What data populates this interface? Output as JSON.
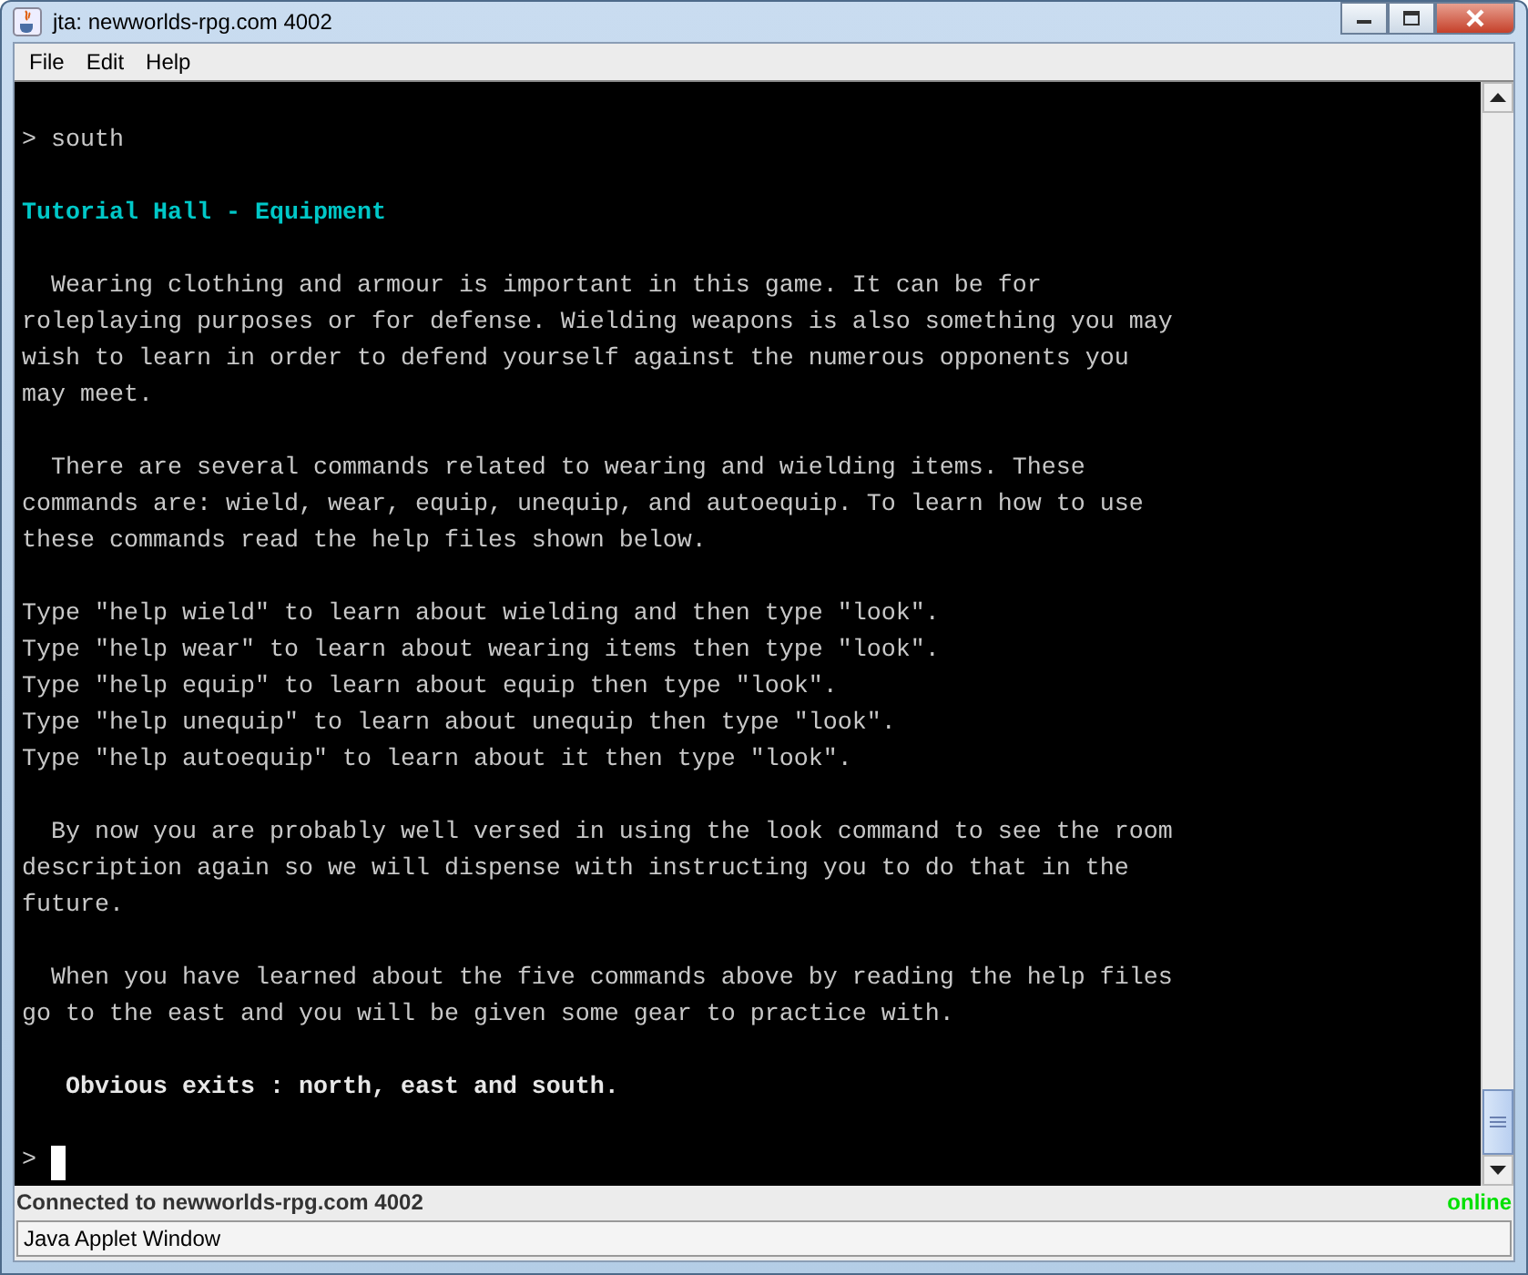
{
  "window": {
    "title": "jta: newworlds-rpg.com 4002"
  },
  "menu": [
    "File",
    "Edit",
    "Help"
  ],
  "terminal": {
    "lines": [
      {
        "kind": "blank"
      },
      {
        "kind": "text",
        "text": "> south"
      },
      {
        "kind": "blank"
      },
      {
        "kind": "heading",
        "text": "Tutorial Hall - Equipment"
      },
      {
        "kind": "blank"
      },
      {
        "kind": "text",
        "text": "  Wearing clothing and armour is important in this game. It can be for"
      },
      {
        "kind": "text",
        "text": "roleplaying purposes or for defense. Wielding weapons is also something you may"
      },
      {
        "kind": "text",
        "text": "wish to learn in order to defend yourself against the numerous opponents you"
      },
      {
        "kind": "text",
        "text": "may meet."
      },
      {
        "kind": "blank"
      },
      {
        "kind": "text",
        "text": "  There are several commands related to wearing and wielding items. These"
      },
      {
        "kind": "text",
        "text": "commands are: wield, wear, equip, unequip, and autoequip. To learn how to use"
      },
      {
        "kind": "text",
        "text": "these commands read the help files shown below."
      },
      {
        "kind": "blank"
      },
      {
        "kind": "text",
        "text": "Type \"help wield\" to learn about wielding and then type \"look\"."
      },
      {
        "kind": "text",
        "text": "Type \"help wear\" to learn about wearing items then type \"look\"."
      },
      {
        "kind": "text",
        "text": "Type \"help equip\" to learn about equip then type \"look\"."
      },
      {
        "kind": "text",
        "text": "Type \"help unequip\" to learn about unequip then type \"look\"."
      },
      {
        "kind": "text",
        "text": "Type \"help autoequip\" to learn about it then type \"look\"."
      },
      {
        "kind": "blank"
      },
      {
        "kind": "text",
        "text": "  By now you are probably well versed in using the look command to see the room"
      },
      {
        "kind": "text",
        "text": "description again so we will dispense with instructing you to do that in the"
      },
      {
        "kind": "text",
        "text": "future."
      },
      {
        "kind": "blank"
      },
      {
        "kind": "text",
        "text": "  When you have learned about the five commands above by reading the help files"
      },
      {
        "kind": "text",
        "text": "go to the east and you will be given some gear to practice with."
      },
      {
        "kind": "blank"
      },
      {
        "kind": "bold",
        "text": "   Obvious exits : north, east and south."
      },
      {
        "kind": "blank"
      },
      {
        "kind": "prompt",
        "text": ">"
      }
    ]
  },
  "status": {
    "text": "Connected to newworlds-rpg.com 4002",
    "state": "online"
  },
  "applet_bar": "Java Applet Window"
}
